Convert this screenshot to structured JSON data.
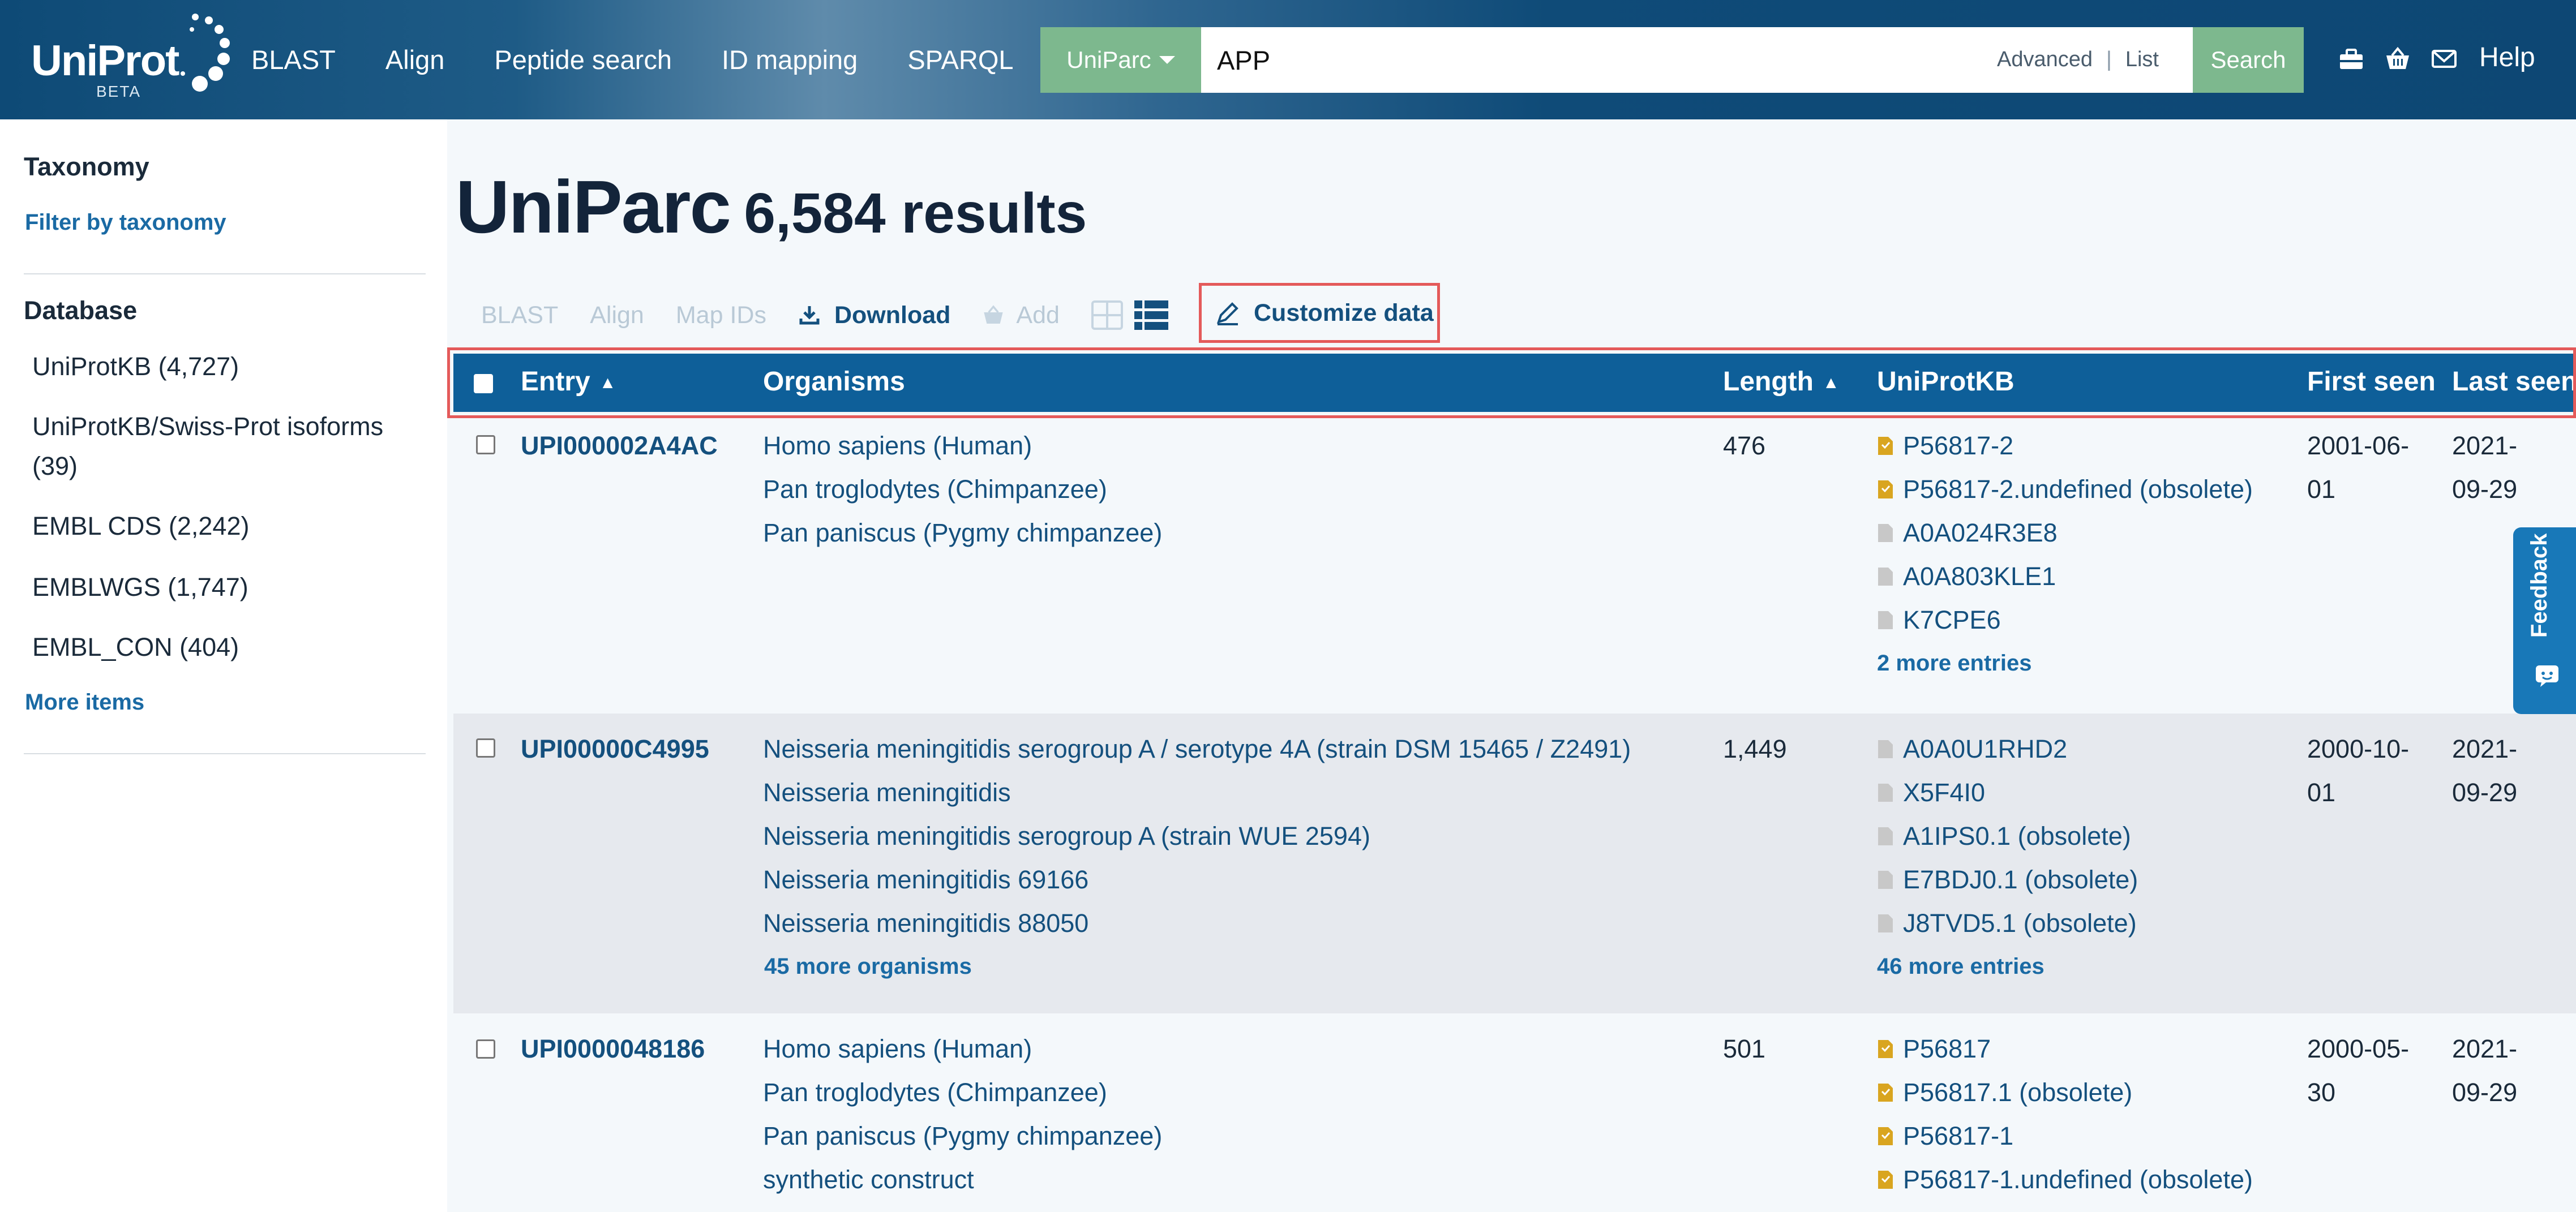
{
  "header": {
    "logo": {
      "name": "UniProt",
      "badge": "BETA"
    },
    "nav": [
      "BLAST",
      "Align",
      "Peptide search",
      "ID mapping",
      "SPARQL"
    ],
    "search": {
      "database": "UniParc",
      "query": "APP",
      "advanced_label": "Advanced",
      "list_label": "List",
      "button_label": "Search"
    },
    "icons": [
      "toolbox-icon",
      "basket-icon",
      "mail-icon"
    ],
    "help_label": "Help"
  },
  "sidebar": {
    "taxonomy": {
      "heading": "Taxonomy",
      "filter_link": "Filter by taxonomy"
    },
    "database": {
      "heading": "Database",
      "items": [
        "UniProtKB (4,727)",
        "UniProtKB/Swiss-Prot isoforms",
        "(39)",
        "EMBL CDS (2,242)",
        "EMBLWGS (1,747)",
        "EMBL_CON (404)"
      ],
      "more_items": "More items"
    }
  },
  "main": {
    "title": "UniParc",
    "results": "6,584 results",
    "toolbar": {
      "blast": "BLAST",
      "align": "Align",
      "map_ids": "Map IDs",
      "download": "Download",
      "add": "Add",
      "customize": "Customize data"
    },
    "table": {
      "columns": {
        "entry": "Entry",
        "organisms": "Organisms",
        "length": "Length",
        "uniprotkb": "UniProtKB",
        "first_seen": "First seen",
        "last_seen": "Last seen"
      },
      "sort_arrow": "▲",
      "rows": [
        {
          "entry": "UPI000002A4AC",
          "organisms": [
            "Homo sapiens (Human)",
            "Pan troglodytes (Chimpanzee)",
            "Pan paniscus (Pygmy chimpanzee)"
          ],
          "length": "476",
          "uniprotkb": [
            "P56817-2",
            "P56817-2.undefined (obsolete)",
            "A0A024R3E8",
            "A0A803KLE1",
            "K7CPE6"
          ],
          "uniprotkb_reviewed": [
            true,
            true,
            false,
            false,
            false
          ],
          "uniprotkb_more": "2 more entries",
          "first_seen": [
            "2001-06-",
            "01"
          ],
          "last_seen": [
            "2021-",
            "09-29"
          ]
        },
        {
          "entry": "UPI00000C4995",
          "organisms": [
            "Neisseria meningitidis serogroup A / serotype 4A (strain DSM 15465 / Z2491)",
            "Neisseria meningitidis",
            "Neisseria meningitidis serogroup A (strain WUE 2594)",
            "Neisseria meningitidis 69166",
            "Neisseria meningitidis 88050"
          ],
          "organisms_more": "45 more organisms",
          "length": "1,449",
          "uniprotkb": [
            "A0A0U1RHD2",
            "X5F4I0",
            "A1IPS0.1 (obsolete)",
            "E7BDJ0.1 (obsolete)",
            "J8TVD5.1 (obsolete)"
          ],
          "uniprotkb_reviewed": [
            false,
            false,
            false,
            false,
            false
          ],
          "uniprotkb_more": "46 more entries",
          "first_seen": [
            "2000-10-",
            "01"
          ],
          "last_seen": [
            "2021-",
            "09-29"
          ]
        },
        {
          "entry": "UPI0000048186",
          "organisms": [
            "Homo sapiens (Human)",
            "Pan troglodytes (Chimpanzee)",
            "Pan paniscus (Pygmy chimpanzee)",
            "synthetic construct"
          ],
          "length": "501",
          "uniprotkb": [
            "P56817",
            "P56817.1 (obsolete)",
            "P56817-1",
            "P56817-1.undefined (obsolete)"
          ],
          "uniprotkb_reviewed": [
            true,
            true,
            true,
            true
          ],
          "first_seen": [
            "2000-05-",
            "30"
          ],
          "last_seen": [
            "2021-",
            "09-29"
          ]
        }
      ]
    }
  },
  "feedback": {
    "label": "Feedback"
  },
  "colors": {
    "header_bg": "#0e4a76",
    "accent_green": "#7db88e",
    "table_header": "#0e5f99",
    "link": "#14507e",
    "highlight_box": "#e45a5a",
    "reviewed_icon": "#d9a520",
    "unreviewed_icon": "#c8c8c8"
  }
}
